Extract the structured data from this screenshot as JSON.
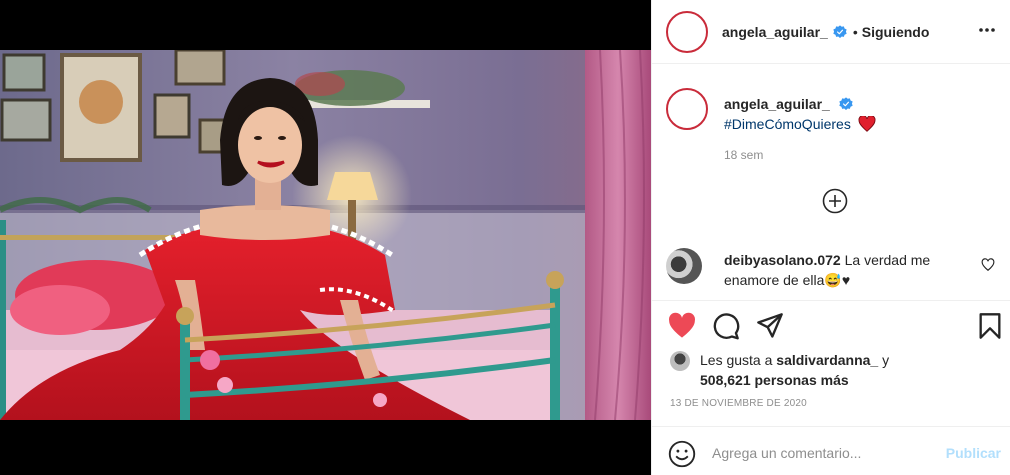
{
  "post": {
    "username": "angela_aguilar_",
    "follow_separator": "•",
    "follow_status": "Siguiendo",
    "caption_hashtag": "#DimeCómoQuieres",
    "caption_emoji": "red-heart",
    "time_ago": "18 sem",
    "date": "13 DE NOVIEMBRE DE 2020"
  },
  "comments": [
    {
      "username": "deibyasolano.072",
      "text": "La verdad me enamore de ella😅♥"
    }
  ],
  "likes": {
    "prefix": "Les gusta a",
    "user": "saldivardanna_",
    "connector": "y",
    "count_text": "508,621 personas más"
  },
  "composer": {
    "placeholder": "Agrega un comentario...",
    "publish_label": "Publicar"
  },
  "icons": {
    "verified": "verified-badge-icon",
    "more": "more-options-icon",
    "load_more": "plus-circle-icon",
    "like": "heart-filled-icon",
    "comment": "comment-bubble-icon",
    "share": "paper-plane-icon",
    "save": "bookmark-icon",
    "emoji": "smiley-icon"
  },
  "colors": {
    "accent_like": "#ed4956",
    "link": "#00376b",
    "verified": "#3897f0",
    "muted": "#8e8e8e",
    "publish_disabled": "#b2dffc"
  }
}
